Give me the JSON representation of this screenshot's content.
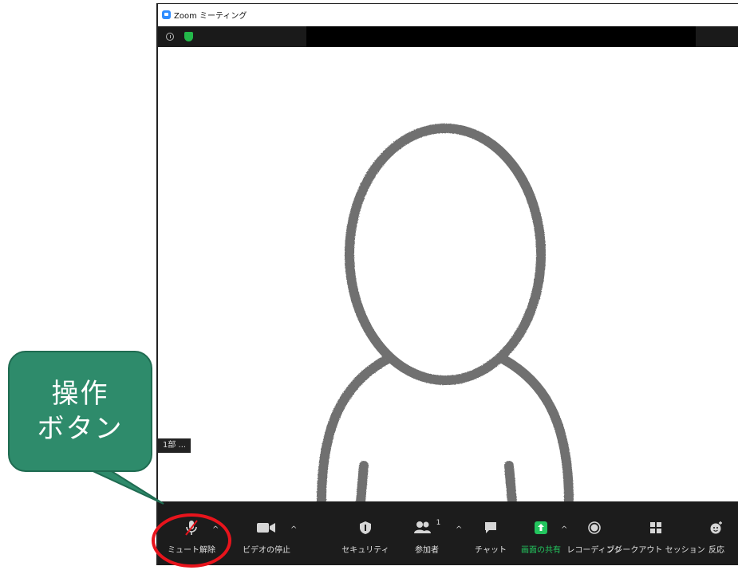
{
  "window": {
    "title": "Zoom ミーティング",
    "participant_tag": "1部 ..."
  },
  "toolbar": {
    "mute_label": "ミュート解除",
    "video_label": "ビデオの停止",
    "security_label": "セキュリティ",
    "participants_label": "参加者",
    "participants_count": "1",
    "chat_label": "チャット",
    "share_label": "画面の共有",
    "record_label": "レコーディング",
    "breakout_label": "ブレークアウト セッション",
    "reactions_label": "反応"
  },
  "callout": {
    "line1": "操作",
    "line2": "ボタン"
  },
  "colors": {
    "callout_fill": "#2e8b6b",
    "highlight_ring": "#e8141c",
    "share_green": "#23c55e",
    "shield_green": "#23b84a",
    "zoom_blue": "#2d8cff"
  }
}
